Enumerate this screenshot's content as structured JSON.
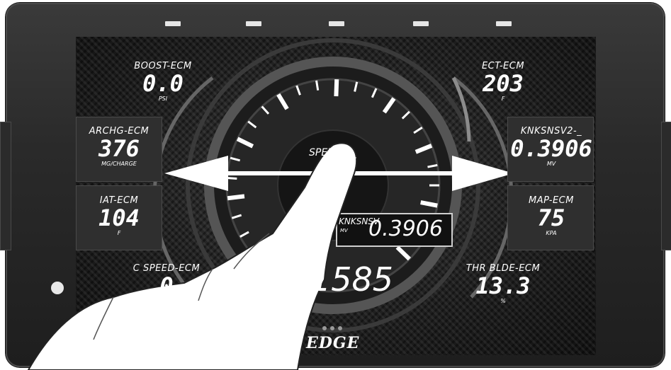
{
  "gauges": {
    "boost": {
      "label": "BOOST-ECM",
      "value": "0.0",
      "unit": "PSI"
    },
    "ect": {
      "label": "ECT-ECM",
      "value": "203",
      "unit": "F"
    },
    "archg": {
      "label": "ARCHG-ECM",
      "value": "376",
      "unit": "MG/CHARGE"
    },
    "knk": {
      "label": "KNKSNSV2-_",
      "value": "0.3906",
      "unit": "MV"
    },
    "iat": {
      "label": "IAT-ECM",
      "value": "104",
      "unit": "F"
    },
    "map": {
      "label": "MAP-ECM",
      "value": "75",
      "unit": "KPA"
    },
    "cspeed": {
      "label": "C SPEED-ECM",
      "value": "0"
    },
    "thr": {
      "label": "THR BLDE-ECM",
      "value": "13.3",
      "unit": "%"
    }
  },
  "center": {
    "label": "SPEED-E_",
    "knk_label": "KNKSNSV",
    "knk_unit": "MV",
    "knk_value": "0.3906",
    "e_label": "E",
    "rpm_value": "1585"
  },
  "brand": "EDGE",
  "page_dots": 3,
  "colors": {
    "screen": "#1e1e1e",
    "text": "#ffffff",
    "bezel": "#2a2a2a"
  },
  "icons": [
    "home-button-icon",
    "hand-pointer-icon",
    "swipe-arrow-icon"
  ]
}
